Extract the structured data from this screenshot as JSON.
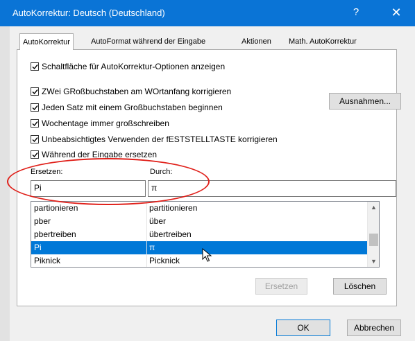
{
  "window": {
    "title": "AutoKorrektur: Deutsch (Deutschland)",
    "help": "?",
    "close": "✕"
  },
  "tabs": [
    "AutoKorrektur",
    "AutoFormat während der Eingabe",
    "Aktionen",
    "Math. AutoKorrektur"
  ],
  "options": {
    "show_buttons": "Schaltfläche für AutoKorrektur-Optionen anzeigen",
    "two_initial_caps": "ZWei GRoßbuchstaben am WOrtanfang korrigieren",
    "capitalize_sentence": "Jeden Satz mit einem Großbuchstaben beginnen",
    "capitalize_days": "Wochentage immer großschreiben",
    "caps_lock": "Unbeabsichtigtes Verwenden der fESTSTELLTASTE korrigieren",
    "replace_while_typing": "Während der Eingabe ersetzen",
    "exceptions_button": "Ausnahmen..."
  },
  "replace": {
    "label_replace": "Ersetzen:",
    "label_with": "Durch:",
    "value_replace": "Pi",
    "value_with": "π",
    "rows": [
      {
        "from": "partionieren",
        "to": "partitionieren"
      },
      {
        "from": "pber",
        "to": "über"
      },
      {
        "from": "pbertreiben",
        "to": "übertreiben"
      },
      {
        "from": "Pi",
        "to": "π"
      },
      {
        "from": "Piknick",
        "to": "Picknick"
      }
    ],
    "replace_button": "Ersetzen",
    "delete_button": "Löschen"
  },
  "footer": {
    "ok": "OK",
    "cancel": "Abbrechen"
  },
  "colors": {
    "titlebar": "#0a74d6",
    "selection": "#0078d7",
    "annotation": "#e0201a"
  }
}
